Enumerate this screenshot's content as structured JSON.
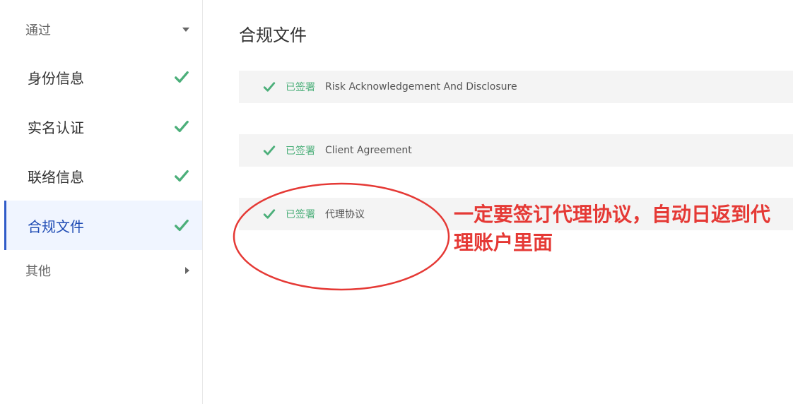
{
  "sidebar": {
    "group_open_label": "通过",
    "items": [
      {
        "label": "身份信息"
      },
      {
        "label": "实名认证"
      },
      {
        "label": "联络信息"
      },
      {
        "label": "合规文件"
      }
    ],
    "group_closed_label": "其他"
  },
  "main": {
    "title": "合规文件",
    "documents": [
      {
        "status": "已签署",
        "name": "Risk Acknowledgement And Disclosure"
      },
      {
        "status": "已签署",
        "name": "Client Agreement"
      },
      {
        "status": "已签署",
        "name": "代理协议"
      }
    ]
  },
  "annotation": {
    "text": "一定要签订代理协议，自动日返到代理账户里面"
  },
  "colors": {
    "check": "#4caf7a",
    "active_accent": "#2f5bc8",
    "annotation": "#e53935"
  }
}
